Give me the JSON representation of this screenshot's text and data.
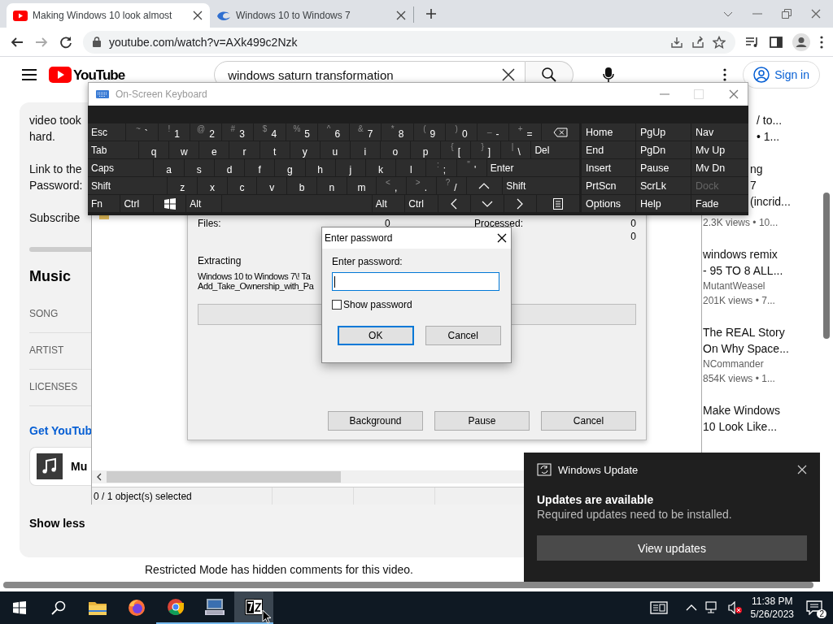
{
  "browser": {
    "tabs": [
      {
        "kind": "video",
        "title": "Making Windows 10 look almost",
        "selected": true
      },
      {
        "kind": "swirl",
        "title": "Windows 10 to Windows 7",
        "selected": false
      }
    ],
    "url": "youtube.com/watch?v=AXk499c2Nzk"
  },
  "youtube": {
    "logo": "YouTube",
    "search": "windows saturn transformation",
    "sign_in": "Sign in",
    "description": [
      "video took\nhard.",
      "Link to the\nPassword:",
      "Subscribe"
    ],
    "music": {
      "heading": "Music",
      "rows": [
        "SONG",
        "ARTIST",
        "LICENSES"
      ]
    },
    "link": "Get YouTub",
    "card_title": "Mu",
    "show_less": "Show less",
    "restricted": "Restricted Mode has hidden comments for this video.",
    "sidebar": [
      {
        "kind": "clipped",
        "lines": [
          "/ to...",
          "• 1..."
        ]
      },
      {
        "kind": "clipped",
        "lines": [
          "ng",
          "7",
          "(incrid..."
        ],
        "meta": [
          "2.3K views • 10..."
        ]
      },
      {
        "kind": "full",
        "lines": [
          "windows remix",
          "- 95 TO 8 ALL..."
        ],
        "meta": [
          "MutantWeasel",
          "201K views • 7..."
        ]
      },
      {
        "kind": "full",
        "lines": [
          "The REAL Story",
          "On Why Space..."
        ],
        "meta": [
          "NCommander",
          "854K views • 1..."
        ]
      },
      {
        "kind": "full",
        "lines": [
          "Make Windows",
          "10 Look Like..."
        ]
      }
    ]
  },
  "sevenzip": {
    "status": "0 / 1 object(s) selected",
    "progress": {
      "stats": [
        {
          "label": "Files:",
          "value": "0"
        },
        {
          "label": "Processed:",
          "value": "0"
        }
      ],
      "extra_value": "0",
      "operation": "Extracting",
      "path": [
        "Windows 10 to Windows 7\\! Ta",
        "Add_Take_Ownership_with_Pa"
      ],
      "level": 0,
      "buttons": [
        "Background",
        "Pause",
        "Cancel"
      ]
    }
  },
  "password_dialog": {
    "title": "Enter password",
    "label": "Enter password:",
    "show_password": {
      "label": "Show password",
      "checked": false
    },
    "buttons": [
      {
        "label": "OK",
        "default": true
      },
      {
        "label": "Cancel",
        "default": false
      }
    ]
  },
  "keyboard": {
    "title": "On-Screen Keyboard",
    "rows": [
      [
        {
          "kind": "label",
          "main": "Esc"
        },
        {
          "kind": "char",
          "main": "`",
          "shift": "~"
        },
        {
          "kind": "char",
          "main": "1",
          "shift": "!"
        },
        {
          "kind": "char",
          "main": "2",
          "shift": "@"
        },
        {
          "kind": "char",
          "main": "3",
          "shift": "#"
        },
        {
          "kind": "char",
          "main": "4",
          "shift": "$"
        },
        {
          "kind": "char",
          "main": "5",
          "shift": "%"
        },
        {
          "kind": "char",
          "main": "6",
          "shift": "^"
        },
        {
          "kind": "char",
          "main": "7",
          "shift": "&"
        },
        {
          "kind": "char",
          "main": "8",
          "shift": "*"
        },
        {
          "kind": "char",
          "main": "9",
          "shift": "("
        },
        {
          "kind": "char",
          "main": "0",
          "shift": ")"
        },
        {
          "kind": "char",
          "main": "-",
          "shift": "_"
        },
        {
          "kind": "char",
          "main": "=",
          "shift": "+"
        },
        {
          "kind": "backspace"
        }
      ],
      [
        {
          "kind": "label",
          "main": "Tab"
        },
        {
          "kind": "char",
          "main": "q"
        },
        {
          "kind": "char",
          "main": "w"
        },
        {
          "kind": "char",
          "main": "e"
        },
        {
          "kind": "char",
          "main": "r"
        },
        {
          "kind": "char",
          "main": "t"
        },
        {
          "kind": "char",
          "main": "y"
        },
        {
          "kind": "char",
          "main": "u"
        },
        {
          "kind": "char",
          "main": "i"
        },
        {
          "kind": "char",
          "main": "o"
        },
        {
          "kind": "char",
          "main": "p"
        },
        {
          "kind": "char",
          "main": "[",
          "shift": "{"
        },
        {
          "kind": "char",
          "main": "]",
          "shift": "}"
        },
        {
          "kind": "char",
          "main": "\\",
          "shift": "|"
        },
        {
          "kind": "label",
          "main": "Del"
        }
      ],
      [
        {
          "kind": "label",
          "main": "Caps"
        },
        {
          "kind": "char",
          "main": "a"
        },
        {
          "kind": "char",
          "main": "s"
        },
        {
          "kind": "char",
          "main": "d"
        },
        {
          "kind": "char",
          "main": "f"
        },
        {
          "kind": "char",
          "main": "g"
        },
        {
          "kind": "char",
          "main": "h"
        },
        {
          "kind": "char",
          "main": "j"
        },
        {
          "kind": "char",
          "main": "k"
        },
        {
          "kind": "char",
          "main": "l"
        },
        {
          "kind": "char",
          "main": ";",
          "shift": ":"
        },
        {
          "kind": "char",
          "main": "'",
          "shift": "\""
        },
        {
          "kind": "label",
          "main": "Enter"
        }
      ],
      [
        {
          "kind": "label",
          "main": "Shift"
        },
        {
          "kind": "char",
          "main": "z"
        },
        {
          "kind": "char",
          "main": "x"
        },
        {
          "kind": "char",
          "main": "c"
        },
        {
          "kind": "char",
          "main": "v"
        },
        {
          "kind": "char",
          "main": "b"
        },
        {
          "kind": "char",
          "main": "n"
        },
        {
          "kind": "char",
          "main": "m"
        },
        {
          "kind": "char",
          "main": ",",
          "shift": "<"
        },
        {
          "kind": "char",
          "main": ".",
          "shift": ">"
        },
        {
          "kind": "char",
          "main": "/",
          "shift": "?"
        },
        {
          "kind": "up"
        },
        {
          "kind": "label",
          "main": "Shift"
        }
      ],
      [
        {
          "kind": "label",
          "main": "Fn"
        },
        {
          "kind": "label",
          "main": "Ctrl"
        },
        {
          "kind": "windows"
        },
        {
          "kind": "label",
          "main": "Alt"
        },
        {
          "kind": "space"
        },
        {
          "kind": "label",
          "main": "Alt"
        },
        {
          "kind": "label",
          "main": "Ctrl"
        },
        {
          "kind": "left"
        },
        {
          "kind": "down"
        },
        {
          "kind": "right"
        },
        {
          "kind": "menu"
        }
      ]
    ],
    "nav": [
      {
        "label": "Home",
        "disabled": false
      },
      {
        "label": "PgUp",
        "disabled": false
      },
      {
        "label": "Nav",
        "disabled": false
      },
      {
        "label": "End",
        "disabled": false
      },
      {
        "label": "PgDn",
        "disabled": false
      },
      {
        "label": "Mv Up",
        "disabled": false
      },
      {
        "label": "Insert",
        "disabled": false
      },
      {
        "label": "Pause",
        "disabled": false
      },
      {
        "label": "Mv Dn",
        "disabled": false
      },
      {
        "label": "PrtScn",
        "disabled": false
      },
      {
        "label": "ScrLk",
        "disabled": false
      },
      {
        "label": "Dock",
        "disabled": true
      },
      {
        "label": "Options",
        "disabled": false
      },
      {
        "label": "Help",
        "disabled": false
      },
      {
        "label": "Fade",
        "disabled": false
      }
    ]
  },
  "toast": {
    "app": "Windows Update",
    "heading": "Updates are available",
    "body": "Required updates need to be installed.",
    "button": "View updates"
  },
  "taskbar": {
    "apps": [
      {
        "kind": "folder",
        "running": false,
        "selected": false
      },
      {
        "kind": "firefox",
        "running": false,
        "selected": false
      },
      {
        "kind": "chrome",
        "running": true,
        "selected": false
      },
      {
        "kind": "monitor",
        "running": true,
        "selected": false
      },
      {
        "kind": "sevenzip",
        "running": true,
        "selected": true
      }
    ],
    "time": "11:38 PM",
    "date": "5/26/2023",
    "notifications": "2"
  }
}
